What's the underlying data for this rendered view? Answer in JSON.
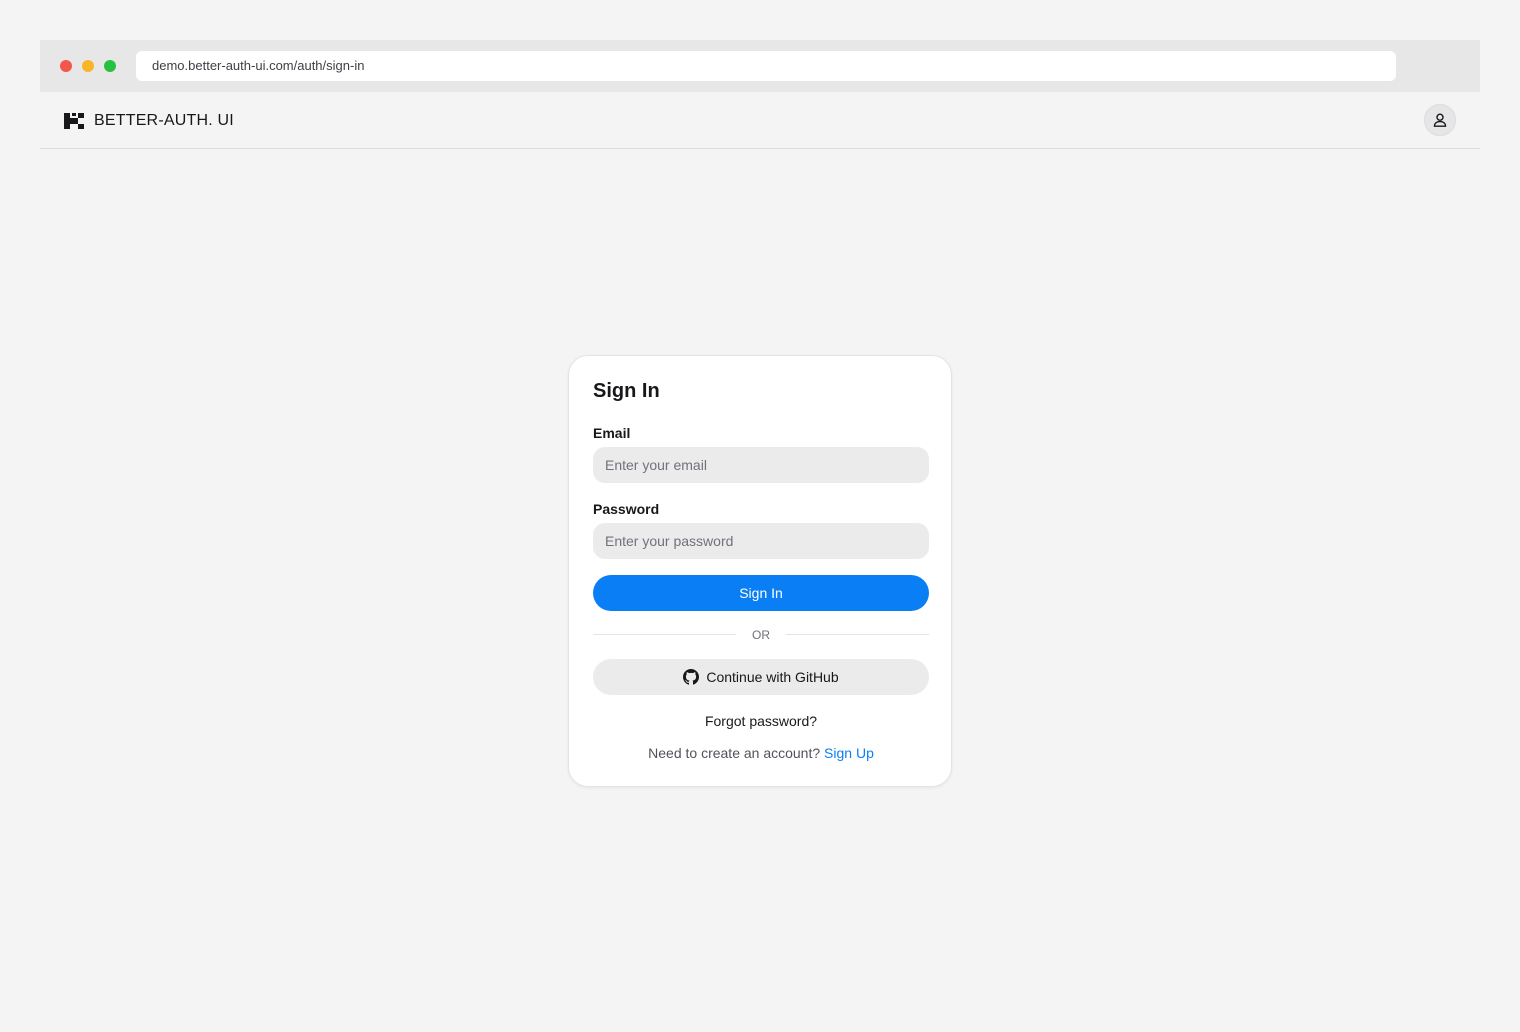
{
  "browser": {
    "url": "demo.better-auth-ui.com/auth/sign-in"
  },
  "header": {
    "brand": "BETTER-AUTH. UI"
  },
  "signin": {
    "title": "Sign In",
    "email_label": "Email",
    "email_placeholder": "Enter your email",
    "email_value": "",
    "password_label": "Password",
    "password_placeholder": "Enter your password",
    "password_value": "",
    "submit_label": "Sign In",
    "divider_text": "OR",
    "github_label": "Continue with GitHub",
    "forgot_label": "Forgot password?",
    "signup_prompt": "Need to create an account?",
    "signup_link": "Sign Up"
  },
  "icons": {
    "logo": "better-auth-logo-icon",
    "user": "user-icon",
    "github": "github-icon"
  },
  "colors": {
    "accent": "#0a7ff5",
    "page_background": "#f4f4f5",
    "card_background": "#ffffff",
    "input_background": "#ebebec"
  }
}
